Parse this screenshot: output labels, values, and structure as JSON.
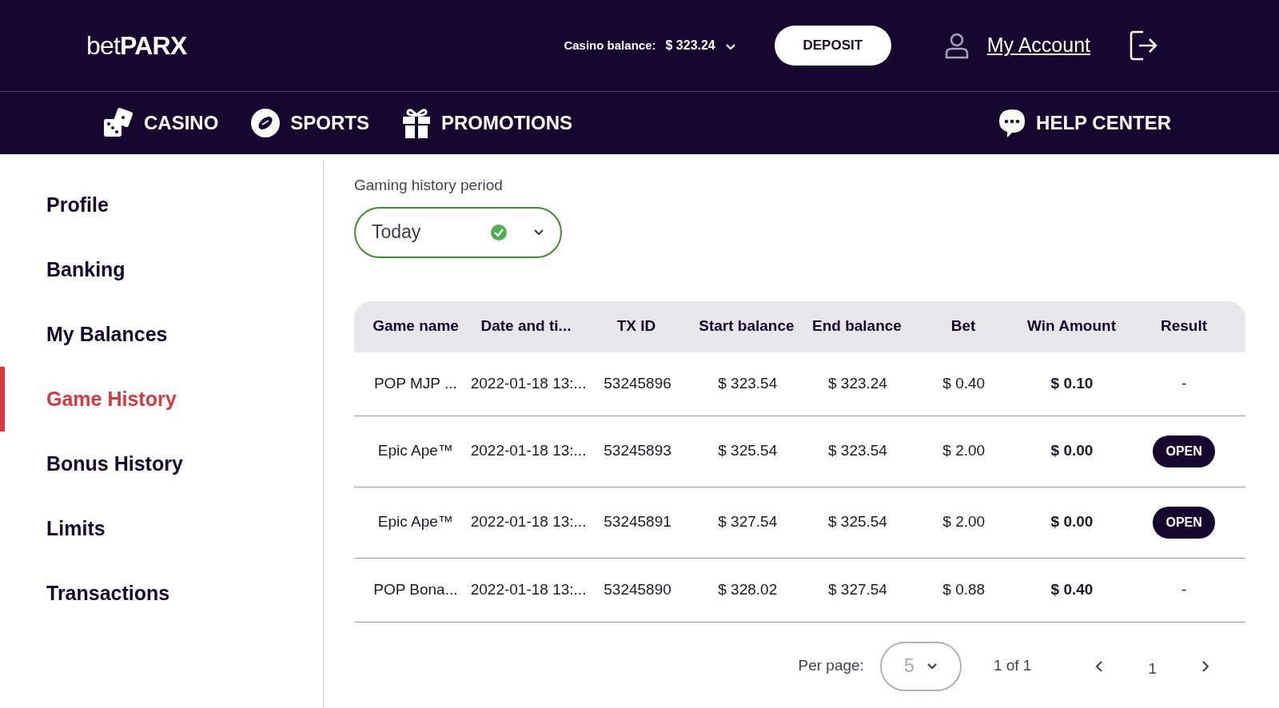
{
  "header": {
    "logo": {
      "light": "bet",
      "bold": "PARX"
    },
    "balance_label": "Casino balance:",
    "balance": "$ 323.24",
    "deposit": "DEPOSIT",
    "account": "My Account"
  },
  "nav": [
    {
      "kind": "casino",
      "label": "CASINO"
    },
    {
      "kind": "sports",
      "label": "SPORTS"
    },
    {
      "kind": "promotions",
      "label": "PROMOTIONS"
    }
  ],
  "help": {
    "label": "HELP CENTER"
  },
  "sidebar": {
    "items": [
      {
        "label": "Profile",
        "selected": false
      },
      {
        "label": "Banking",
        "selected": false
      },
      {
        "label": "My Balances",
        "selected": false
      },
      {
        "label": "Game History",
        "selected": true
      },
      {
        "label": "Bonus History",
        "selected": false
      },
      {
        "label": "Limits",
        "selected": false
      },
      {
        "label": "Transactions",
        "selected": false
      }
    ]
  },
  "period": {
    "label": "Gaming history period",
    "value": "Today",
    "valid": true
  },
  "table": {
    "columns": [
      "Game name",
      "Date and ti...",
      "TX ID",
      "Start balance",
      "End balance",
      "Bet",
      "Win Amount",
      "Result"
    ],
    "rows": [
      {
        "cells": [
          "POP MJP ...",
          "2022-01-18 13:...",
          "53245896",
          "$ 323.54",
          "$ 323.24",
          "$ 0.40",
          "$ 0.10"
        ],
        "result": {
          "kind": "text",
          "label": "-"
        }
      },
      {
        "cells": [
          "Epic Ape™",
          "2022-01-18 13:...",
          "53245893",
          "$ 325.54",
          "$ 323.54",
          "$ 2.00",
          "$ 0.00"
        ],
        "result": {
          "kind": "badge",
          "label": "OPEN"
        }
      },
      {
        "cells": [
          "Epic Ape™",
          "2022-01-18 13:...",
          "53245891",
          "$ 327.54",
          "$ 325.54",
          "$ 2.00",
          "$ 0.00"
        ],
        "result": {
          "kind": "badge",
          "label": "OPEN"
        }
      },
      {
        "cells": [
          "POP Bona...",
          "2022-01-18 13:...",
          "53245890",
          "$ 328.02",
          "$ 327.54",
          "$ 0.88",
          "$ 0.40"
        ],
        "result": {
          "kind": "text",
          "label": "-"
        }
      }
    ]
  },
  "pagination": {
    "per_page_label": "Per page:",
    "per_page": "5",
    "range": "1 of 1",
    "page": "1"
  }
}
